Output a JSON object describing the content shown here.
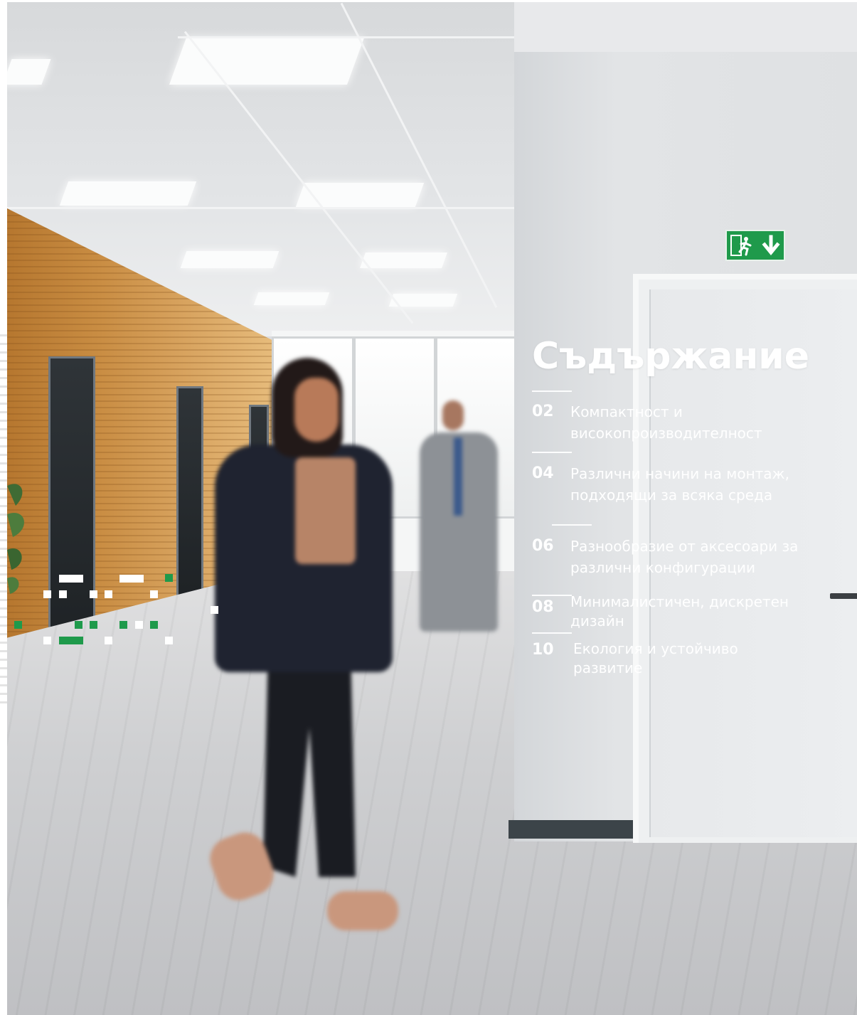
{
  "toc": {
    "title": "Съдържание",
    "items": [
      {
        "number": "02",
        "lines": [
          "Компактност и",
          "високопроизводителност"
        ]
      },
      {
        "number": "04",
        "lines": [
          "Различни начини на монтаж,",
          "подходящи за всяка среда"
        ]
      },
      {
        "number": "06",
        "lines": [
          "Разнообразие от аксесоари за",
          "различни конфигурации"
        ]
      },
      {
        "number": "08",
        "lines": [
          "Минималистичен, дискретен",
          "дизайн"
        ]
      },
      {
        "number": "10",
        "lines": [
          "Екология и устойчиво",
          "развитие"
        ]
      }
    ]
  },
  "colors": {
    "accent_green": "#1f9a4b",
    "text": "#ffffff"
  },
  "icons": {
    "exit_sign": "emergency-exit-sign-icon",
    "pattern": "pixel-dots-pattern"
  }
}
